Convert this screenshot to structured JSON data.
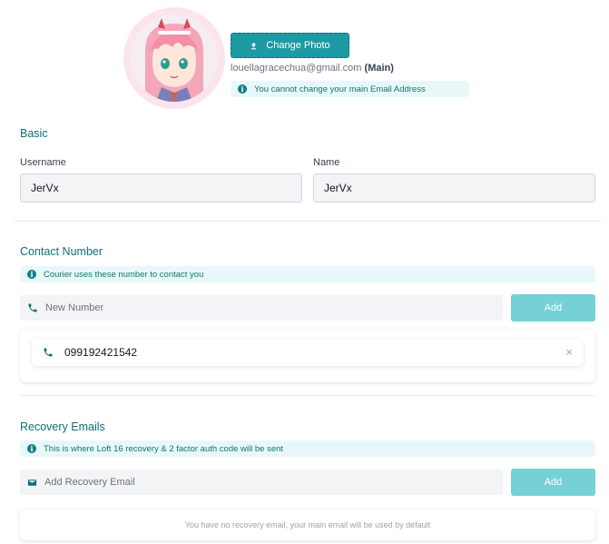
{
  "profile": {
    "change_photo_label": "Change Photo",
    "main_email": "louellagracechua@gmail.com",
    "main_tag": "(Main)",
    "email_notice": "You cannot change your main Email Address"
  },
  "basic": {
    "title": "Basic",
    "username_label": "Username",
    "username_value": "JerVx",
    "name_label": "Name",
    "name_value": "JerVx"
  },
  "contact": {
    "title": "Contact Number",
    "notice": "Courier uses these number to contact you",
    "placeholder": "New Number",
    "add_label": "Add",
    "numbers": [
      "099192421542"
    ],
    "remove_glyph": "×"
  },
  "recovery": {
    "title": "Recovery Emails",
    "notice": "This is where Loft 16 recovery & 2 factor auth code will be sent",
    "placeholder": "Add Recovery Email",
    "add_label": "Add",
    "empty_message": "You have no recovery email, your main email will be used by default"
  },
  "icons": {
    "info": "i",
    "upload": "upload-icon",
    "phone": "phone-icon",
    "mail": "mail-icon"
  },
  "colors": {
    "accent": "#1d9aa3",
    "accent_light": "#75d1d6",
    "notice_bg": "#e8f8f8",
    "title": "#0f6e78"
  }
}
